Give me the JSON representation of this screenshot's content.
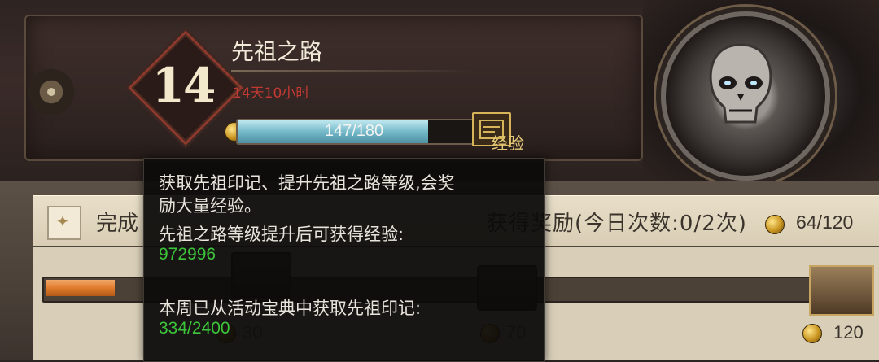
{
  "header": {
    "level": "14",
    "title": "先祖之路",
    "time_remaining": "14天10小时",
    "exp_bar": {
      "text": "147/180",
      "current": 147,
      "max": 180
    },
    "exp_button_label": "经验",
    "exp_button_icon": "scroll-icon"
  },
  "task": {
    "text": "完成",
    "count_text": "获得奖励(今日次数:0/2次)",
    "reward": "64/120"
  },
  "progress": {
    "fill_fraction": 0.09,
    "milestones": [
      {
        "value": "30"
      },
      {
        "value": "70"
      },
      {
        "value": "120"
      }
    ]
  },
  "tooltip": {
    "line1": "获取先祖印记、提升先祖之路等级,会奖",
    "line2": "励大量经验。",
    "line3": "先祖之路等级提升后可获得经验:",
    "value1": "972996",
    "line4": "本周已从活动宝典中获取先祖印记:",
    "value2": "334/2400"
  },
  "colors": {
    "timer": "#c23a33",
    "tooltip_value": "#3cc43a",
    "progress_fill": "#e07b2c",
    "exp_fill": "#74b9c9"
  }
}
